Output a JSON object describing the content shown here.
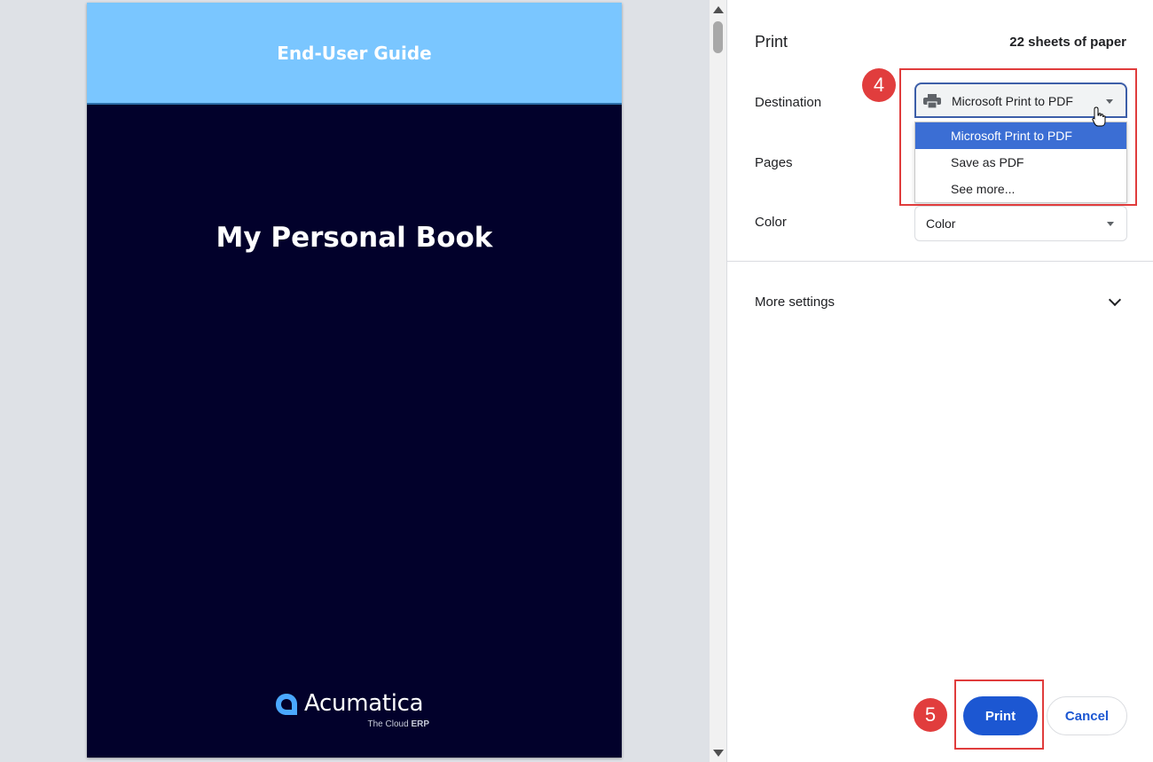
{
  "preview": {
    "header_text": "End-User Guide",
    "book_title": "My Personal Book",
    "logo": {
      "name": "Acumatica",
      "tagline_prefix": "The Cloud",
      "tagline_bold": "ERP"
    }
  },
  "panel": {
    "title": "Print",
    "sheets": "22 sheets of paper",
    "destination": {
      "label": "Destination",
      "value": "Microsoft Print to PDF",
      "icon": "printer-icon",
      "options": [
        "Microsoft Print to PDF",
        "Save as PDF",
        "See more..."
      ],
      "selected_index": 0
    },
    "pages": {
      "label": "Pages"
    },
    "color": {
      "label": "Color",
      "value": "Color"
    },
    "more_settings": {
      "label": "More settings",
      "icon": "chevron-down-icon"
    },
    "buttons": {
      "print": "Print",
      "cancel": "Cancel"
    }
  },
  "annotations": {
    "step_destination": "4",
    "step_print": "5",
    "color": "#e13d3d"
  },
  "colors": {
    "accent": "#1c57d2",
    "dropdown_highlight": "#3b6ed4",
    "page_background": "#02012b",
    "page_header": "#7ac6ff"
  }
}
